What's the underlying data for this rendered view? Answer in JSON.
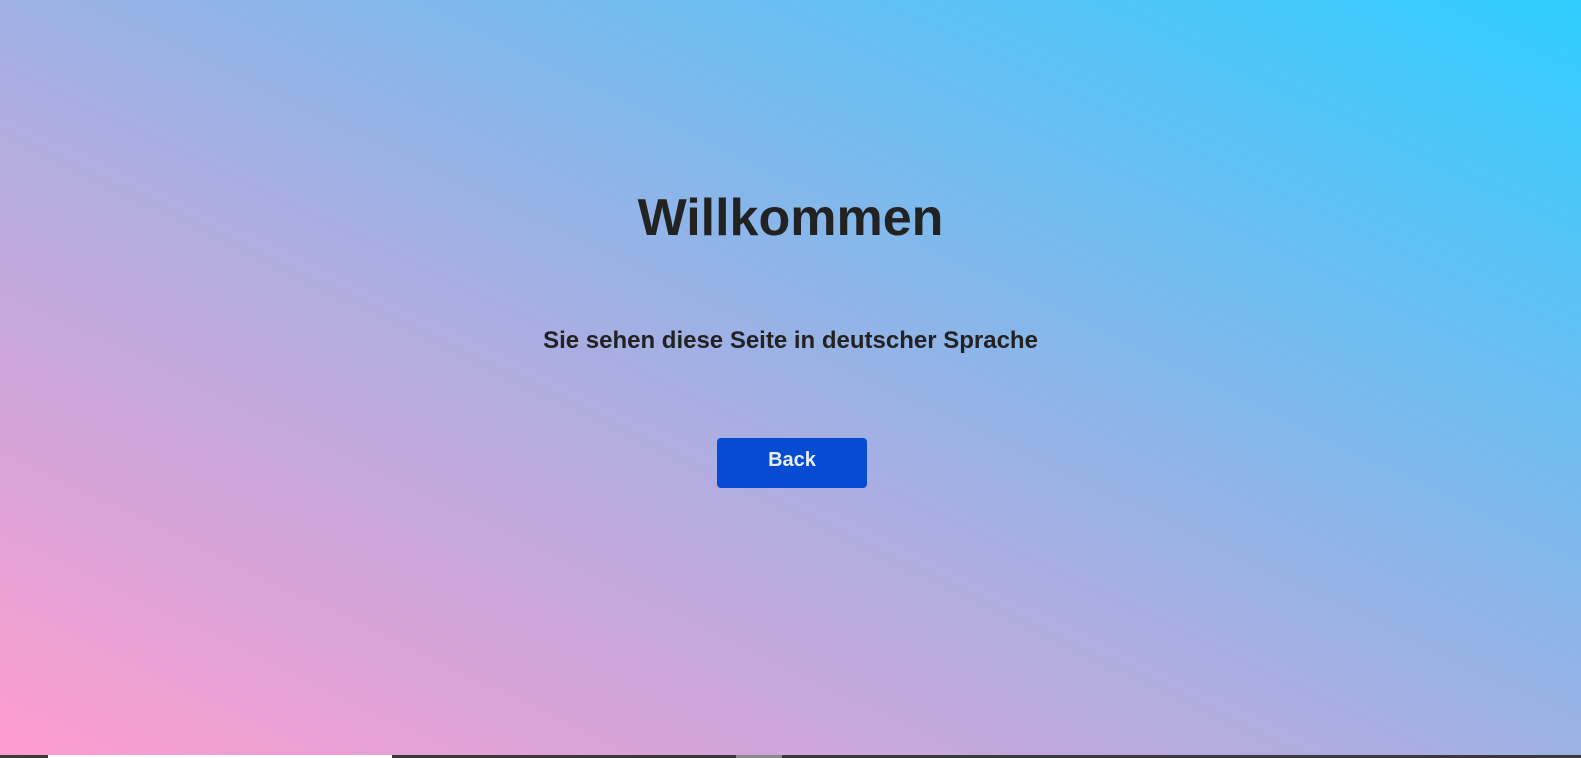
{
  "page": {
    "title": "Willkommen",
    "subtitle": "Sie sehen diese Seite in deutscher Sprache",
    "back_button_label": "Back"
  },
  "colors": {
    "gradient_bottom_left": "#ff9ccf",
    "gradient_middle": "#aaaee2",
    "gradient_top_right": "#2fcdff",
    "button_background": "#064cd3",
    "text": "#222222"
  }
}
